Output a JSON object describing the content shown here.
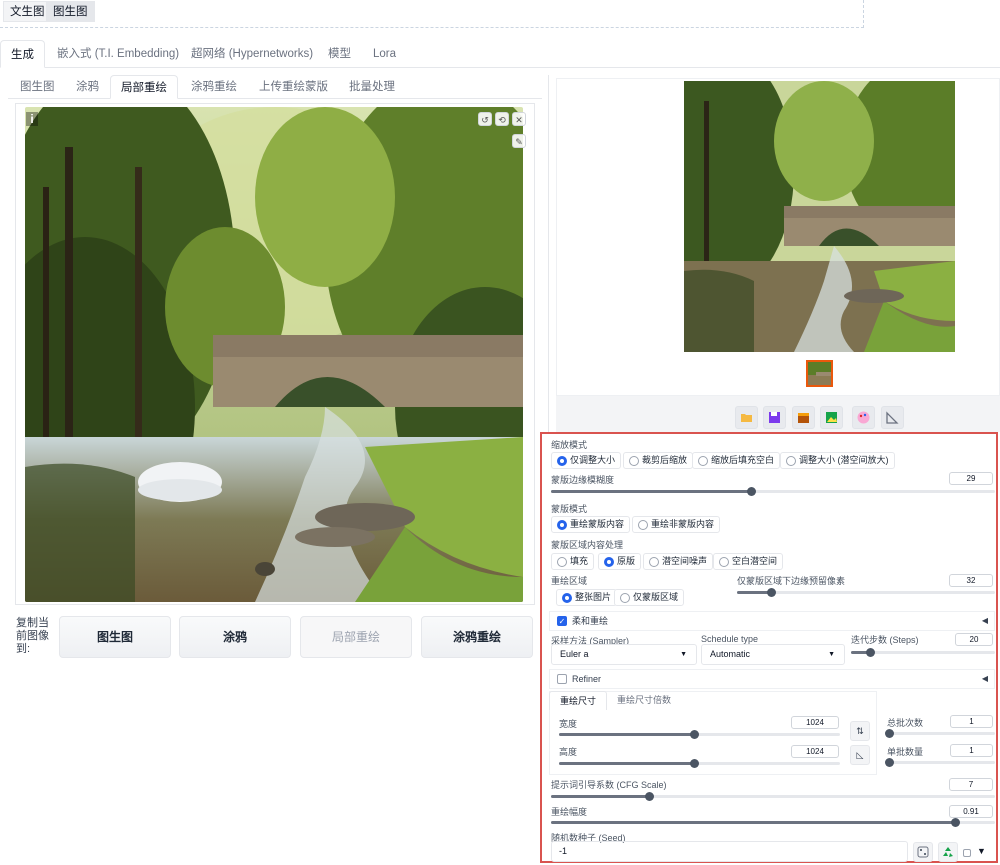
{
  "mode_switch": [
    "文生图",
    "图生图"
  ],
  "main_tabs": [
    "生成",
    "嵌入式 (T.I. Embedding)",
    "超网络 (Hypernetworks)",
    "模型",
    "Lora"
  ],
  "sub_tabs": [
    "图生图",
    "涂鸦",
    "局部重绘",
    "涂鸦重绘",
    "上传重绘蒙版",
    "批量处理"
  ],
  "copy_to": {
    "label": "复制当前图像到:",
    "buttons": [
      "图生图",
      "涂鸦",
      "局部重绘",
      "涂鸦重绘"
    ]
  },
  "settings": {
    "resize_mode": {
      "label": "缩放模式",
      "options": [
        "仅调整大小",
        "裁剪后缩放",
        "缩放后填充空白",
        "调整大小 (潜空间放大)"
      ],
      "selected": 0
    },
    "mask_blur": {
      "label": "蒙版边缘模糊度",
      "value": "29",
      "fraction": 0.45
    },
    "mask_mode": {
      "label": "蒙版模式",
      "options": [
        "重绘蒙版内容",
        "重绘非蒙版内容"
      ],
      "selected": 0
    },
    "masked_content": {
      "label": "蒙版区域内容处理",
      "options": [
        "填充",
        "原版",
        "潜空间噪声",
        "空白潜空间"
      ],
      "selected": 1
    },
    "inpaint_area": {
      "label": "重绘区域",
      "options": [
        "整张图片",
        "仅蒙版区域"
      ],
      "selected": 0
    },
    "only_masked_padding": {
      "label": "仅蒙版区域下边缘预留像素",
      "value": "32",
      "fraction": 0.13
    },
    "soft_inpaint": {
      "label": "柔和重绘",
      "checked": true
    },
    "sampler": {
      "label": "采样方法 (Sampler)",
      "value": "Euler a"
    },
    "schedule": {
      "label": "Schedule type",
      "value": "Automatic"
    },
    "steps": {
      "label": "迭代步数 (Steps)",
      "value": "20",
      "fraction": 0.13
    },
    "refiner": {
      "label": "Refiner",
      "checked": false
    },
    "size_tabs": [
      "重绘尺寸",
      "重绘尺寸倍数"
    ],
    "width": {
      "label": "宽度",
      "value": "1024",
      "fraction": 0.48
    },
    "height": {
      "label": "高度",
      "value": "1024",
      "fraction": 0.48
    },
    "batch_count": {
      "label": "总批次数",
      "value": "1",
      "fraction": 0.0
    },
    "batch_size": {
      "label": "单批数量",
      "value": "1",
      "fraction": 0.0
    },
    "cfg_scale": {
      "label": "提示词引导系数 (CFG Scale)",
      "value": "7",
      "fraction": 0.22
    },
    "denoise": {
      "label": "重绘幅度",
      "value": "0.91",
      "fraction": 0.91
    },
    "seed": {
      "label": "随机数种子 (Seed)",
      "value": "-1"
    }
  },
  "icons": {
    "swap": "⇅",
    "ratio": "◺",
    "dice": "🎲",
    "recycle": "♻",
    "dropdown": "▼",
    "collapse": "◀"
  }
}
